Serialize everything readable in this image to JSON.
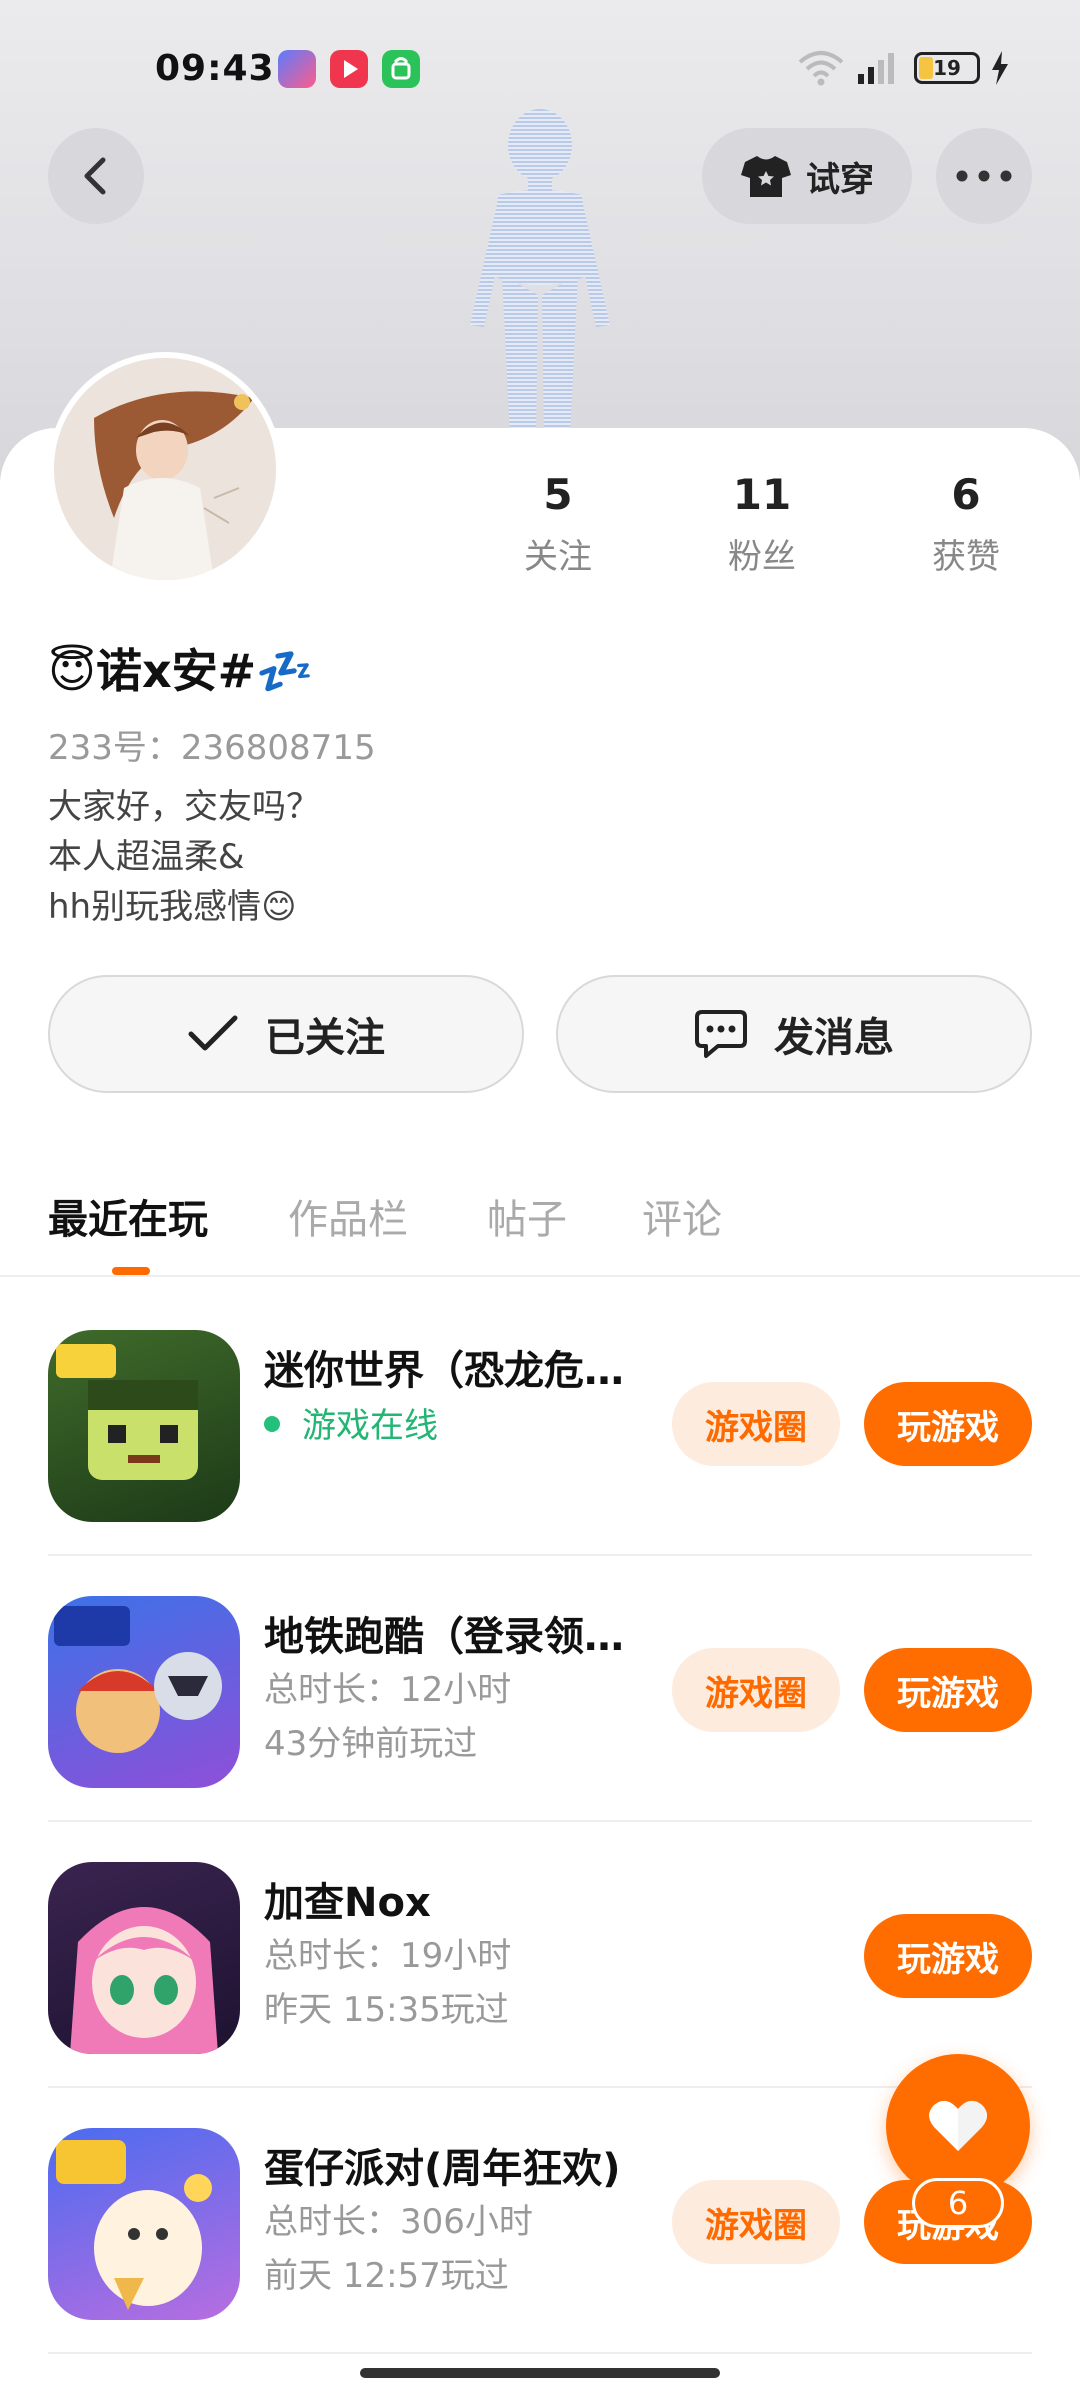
{
  "status_bar": {
    "time": "09:43",
    "battery": "19"
  },
  "header": {
    "tryon_label": "试穿"
  },
  "profile": {
    "nickname": "😇诺x安#💤",
    "uid": "233号：236808715",
    "bio": "大家好，交友吗？\n本人超温柔&\nhh别玩我感情😊",
    "stats": [
      {
        "value": "5",
        "label": "关注"
      },
      {
        "value": "11",
        "label": "粉丝"
      },
      {
        "value": "6",
        "label": "获赞"
      }
    ]
  },
  "actions": {
    "followed_label": "已关注",
    "message_label": "发消息"
  },
  "tabs": [
    {
      "label": "最近在玩",
      "active": true
    },
    {
      "label": "作品栏",
      "active": false
    },
    {
      "label": "帖子",
      "active": false
    },
    {
      "label": "评论",
      "active": false
    }
  ],
  "games": [
    {
      "title": "迷你世界（恐龙危机）",
      "line1": "游戏在线",
      "line2": "",
      "online": true,
      "circle_label": "游戏圈",
      "play_label": "玩游戏"
    },
    {
      "title": "地铁跑酷（登录领奖）",
      "line1": "总时长：12小时",
      "line2": "43分钟前玩过",
      "online": false,
      "circle_label": "游戏圈",
      "play_label": "玩游戏"
    },
    {
      "title": "加查Nox",
      "line1": "总时长：19小时",
      "line2": "昨天 15:35玩过",
      "online": false,
      "circle_label": "",
      "play_label": "玩游戏"
    },
    {
      "title": "蛋仔派对(周年狂欢)",
      "line1": "总时长：306小时",
      "line2": "前天 12:57玩过",
      "online": false,
      "circle_label": "游戏圈",
      "play_label": "玩游戏"
    }
  ],
  "like_fab": {
    "count": "6"
  },
  "colors": {
    "accent": "#ff6d00",
    "online": "#22b573",
    "pill_bg": "#fdebdd"
  }
}
